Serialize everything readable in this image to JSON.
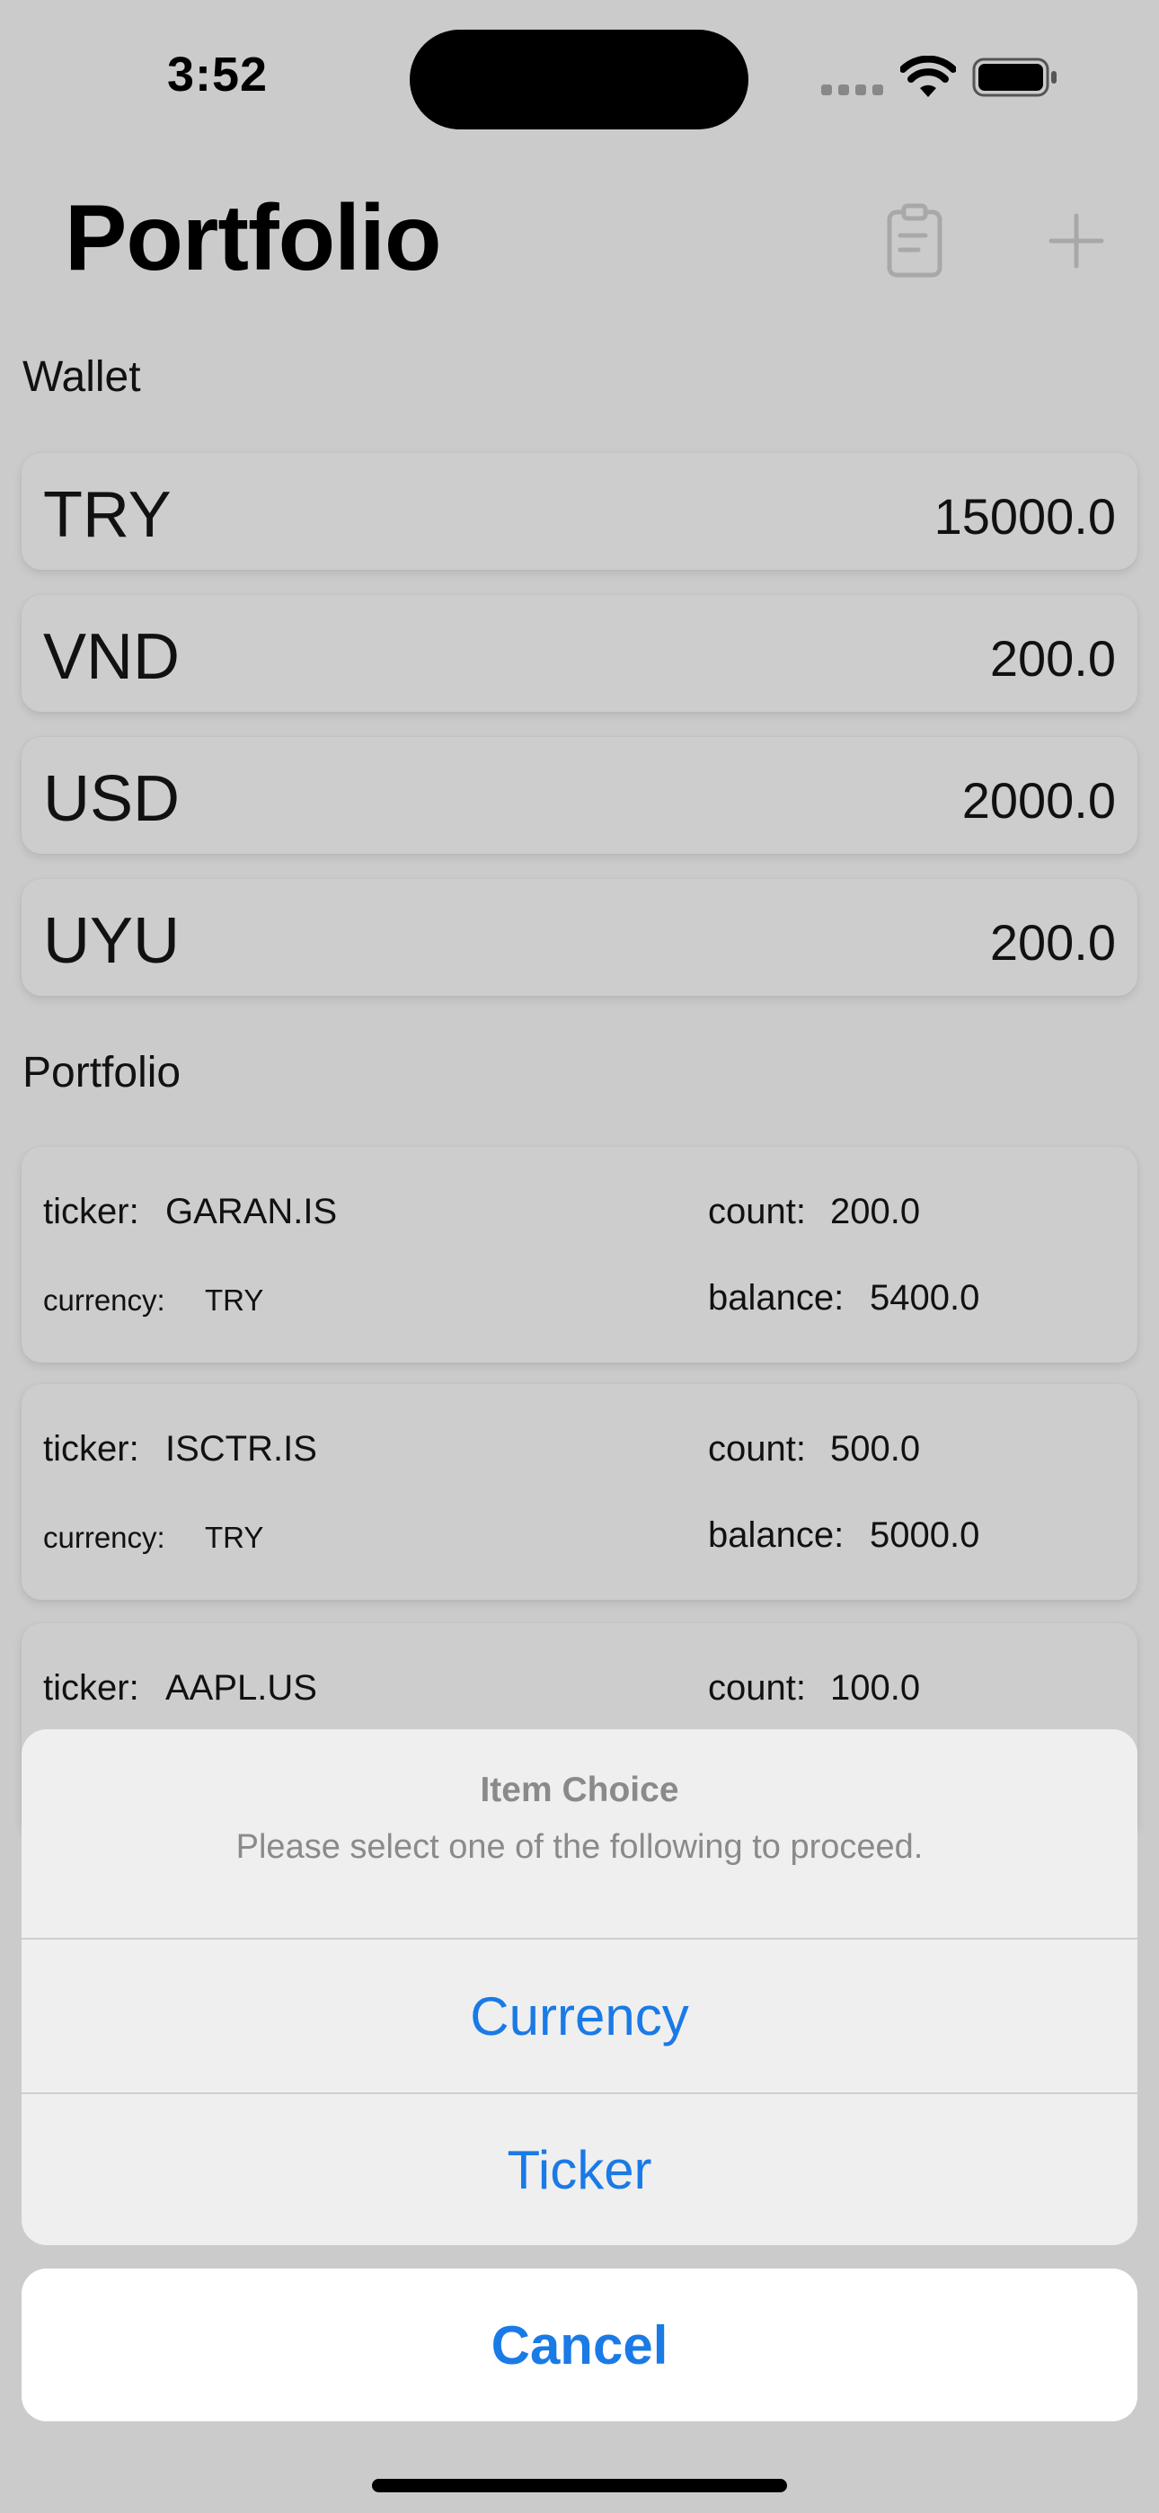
{
  "status": {
    "time": "3:52"
  },
  "header": {
    "title": "Portfolio"
  },
  "wallet": {
    "section_title": "Wallet",
    "items": [
      {
        "code": "TRY",
        "amount": "15000.0"
      },
      {
        "code": "VND",
        "amount": "200.0"
      },
      {
        "code": "USD",
        "amount": "2000.0"
      },
      {
        "code": "UYU",
        "amount": "200.0"
      }
    ]
  },
  "portfolio": {
    "section_title": "Portfolio",
    "labels": {
      "ticker": "ticker:",
      "currency": "currency:",
      "count": "count:",
      "balance": "balance:"
    },
    "items": [
      {
        "ticker": "GARAN.IS",
        "currency": "TRY",
        "count": "200.0",
        "balance": "5400.0"
      },
      {
        "ticker": "ISCTR.IS",
        "currency": "TRY",
        "count": "500.0",
        "balance": "5000.0"
      },
      {
        "ticker": "AAPL.US",
        "count": "100.0"
      }
    ]
  },
  "action_sheet": {
    "title": "Item Choice",
    "message": "Please select one of the following to proceed.",
    "actions": [
      "Currency",
      "Ticker"
    ],
    "cancel": "Cancel"
  },
  "icons": {
    "clipboard": "clipboard-icon",
    "add": "plus-icon",
    "wifi": "wifi-icon",
    "battery": "battery-icon",
    "cellular": "cellular-icon"
  },
  "colors": {
    "accent": "#1a7ae6",
    "dimmed_background": "#cbcbcb"
  }
}
